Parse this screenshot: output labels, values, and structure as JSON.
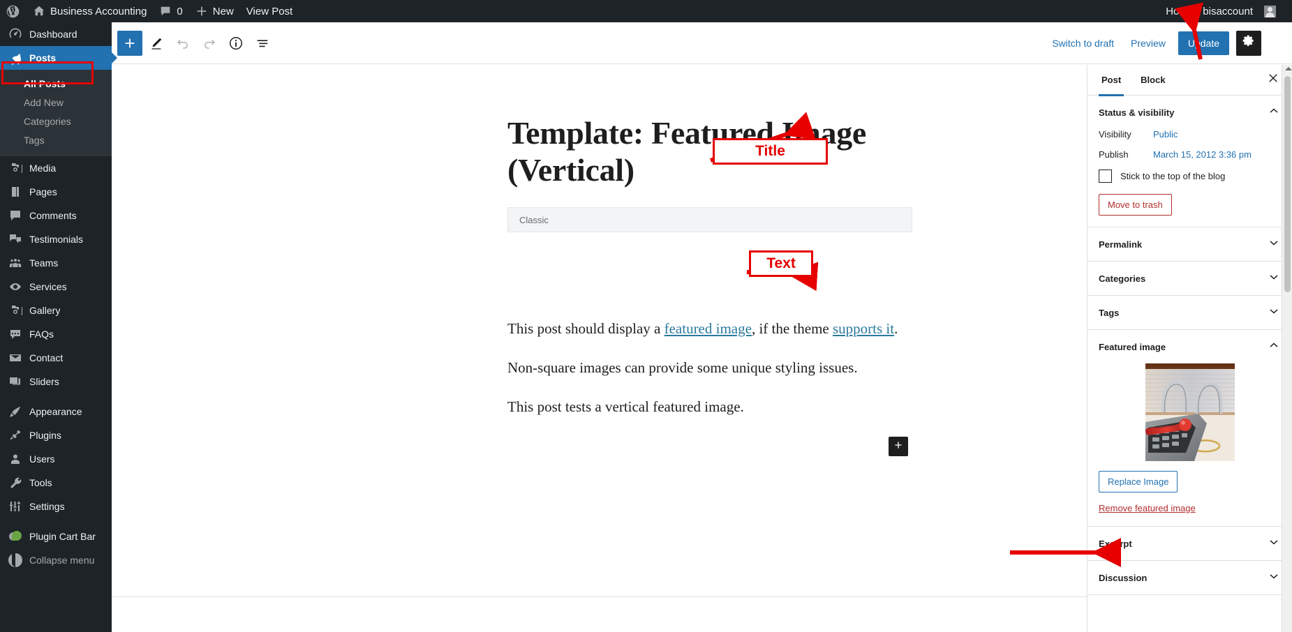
{
  "adminbar": {
    "logo_icon": "wordpress-logo-icon",
    "site_name": "Business Accounting",
    "comments_icon": "comment-bubble-icon",
    "comments_count": "0",
    "new_icon": "plus-icon",
    "new_label": "New",
    "view_post_label": "View Post",
    "howdy": "Howdy, bisaccount",
    "avatar_icon": "user-avatar-icon"
  },
  "sidebar": {
    "items": [
      {
        "label": "Dashboard",
        "icon": "dashboard-icon",
        "current": false
      },
      {
        "label": "Posts",
        "icon": "pin-icon",
        "current": true
      },
      {
        "label": "Media",
        "icon": "media-icon",
        "current": false
      },
      {
        "label": "Pages",
        "icon": "pages-icon",
        "current": false
      },
      {
        "label": "Comments",
        "icon": "comments-icon",
        "current": false
      },
      {
        "label": "Testimonials",
        "icon": "testimonials-icon",
        "current": false
      },
      {
        "label": "Teams",
        "icon": "teams-icon",
        "current": false
      },
      {
        "label": "Services",
        "icon": "services-icon",
        "current": false
      },
      {
        "label": "Gallery",
        "icon": "gallery-icon",
        "current": false
      },
      {
        "label": "FAQs",
        "icon": "faqs-icon",
        "current": false
      },
      {
        "label": "Contact",
        "icon": "envelope-icon",
        "current": false
      },
      {
        "label": "Sliders",
        "icon": "sliders-icon",
        "current": false
      },
      {
        "label": "Appearance",
        "icon": "appearance-brush-icon",
        "current": false
      },
      {
        "label": "Plugins",
        "icon": "plugins-plug-icon",
        "current": false
      },
      {
        "label": "Users",
        "icon": "users-icon",
        "current": false
      },
      {
        "label": "Tools",
        "icon": "tools-wrench-icon",
        "current": false
      },
      {
        "label": "Settings",
        "icon": "settings-sliders-icon",
        "current": false
      },
      {
        "label": "Plugin Cart Bar",
        "icon": "plugin-cart-bar-icon",
        "current": false
      },
      {
        "label": "Collapse menu",
        "icon": "collapse-arrow-icon",
        "current": false
      }
    ],
    "posts_submenu": [
      {
        "label": "All Posts",
        "current": true
      },
      {
        "label": "Add New",
        "current": false
      },
      {
        "label": "Categories",
        "current": false
      },
      {
        "label": "Tags",
        "current": false
      }
    ]
  },
  "header": {
    "add_block_icon": "plus-icon",
    "edit_tool_icon": "pencil-icon",
    "undo_icon": "undo-arrow-icon",
    "redo_icon": "redo-arrow-icon",
    "details_icon": "info-circle-icon",
    "list_view_icon": "list-view-icon",
    "switch_to_draft": "Switch to draft",
    "preview": "Preview",
    "update": "Update",
    "settings_icon": "gear-icon",
    "more_options_icon": "three-dots-vertical-icon"
  },
  "content": {
    "title": "Template: Featured Image (Vertical)",
    "classic_block_label": "Classic",
    "paragraphs": [
      {
        "before": "This post should display a ",
        "link1": "featured image",
        "middle": ", if the theme ",
        "link2": "supports it",
        "after": "."
      }
    ],
    "paragraph2": "Non-square images can provide some unique styling issues.",
    "paragraph3": "This post tests a vertical featured image.",
    "inserter_icon": "plus-icon"
  },
  "post_sidebar": {
    "tabs": [
      {
        "label": "Post",
        "active": true
      },
      {
        "label": "Block",
        "active": false
      }
    ],
    "close_icon": "close-x-icon",
    "panels": [
      {
        "title": "Status & visibility",
        "expanded": true
      },
      {
        "title": "Permalink",
        "expanded": false
      },
      {
        "title": "Categories",
        "expanded": false
      },
      {
        "title": "Tags",
        "expanded": false
      },
      {
        "title": "Featured image",
        "expanded": true
      },
      {
        "title": "Excerpt",
        "expanded": false
      },
      {
        "title": "Discussion",
        "expanded": false
      }
    ],
    "status": {
      "visibility_label": "Visibility",
      "visibility_value": "Public",
      "publish_label": "Publish",
      "publish_value": "March 15, 2012 3:36 pm",
      "sticky_label": "Stick to the top of the blog",
      "sticky_checked": false,
      "trash_label": "Move to trash"
    },
    "featured_image": {
      "thumbnail_alt": "calculator-red-pen-binder-photo",
      "replace_label": "Replace Image",
      "remove_label": "Remove featured image"
    }
  },
  "annotations": [
    {
      "label": "Title",
      "target": "post-title"
    },
    {
      "label": "Text",
      "target": "post-body-text"
    }
  ],
  "colors": {
    "admin_dark": "#1d2327",
    "admin_darker": "#2c3338",
    "accent_blue": "#2271b1",
    "annotation_red": "#e60000",
    "danger_red": "#b32d2e"
  }
}
